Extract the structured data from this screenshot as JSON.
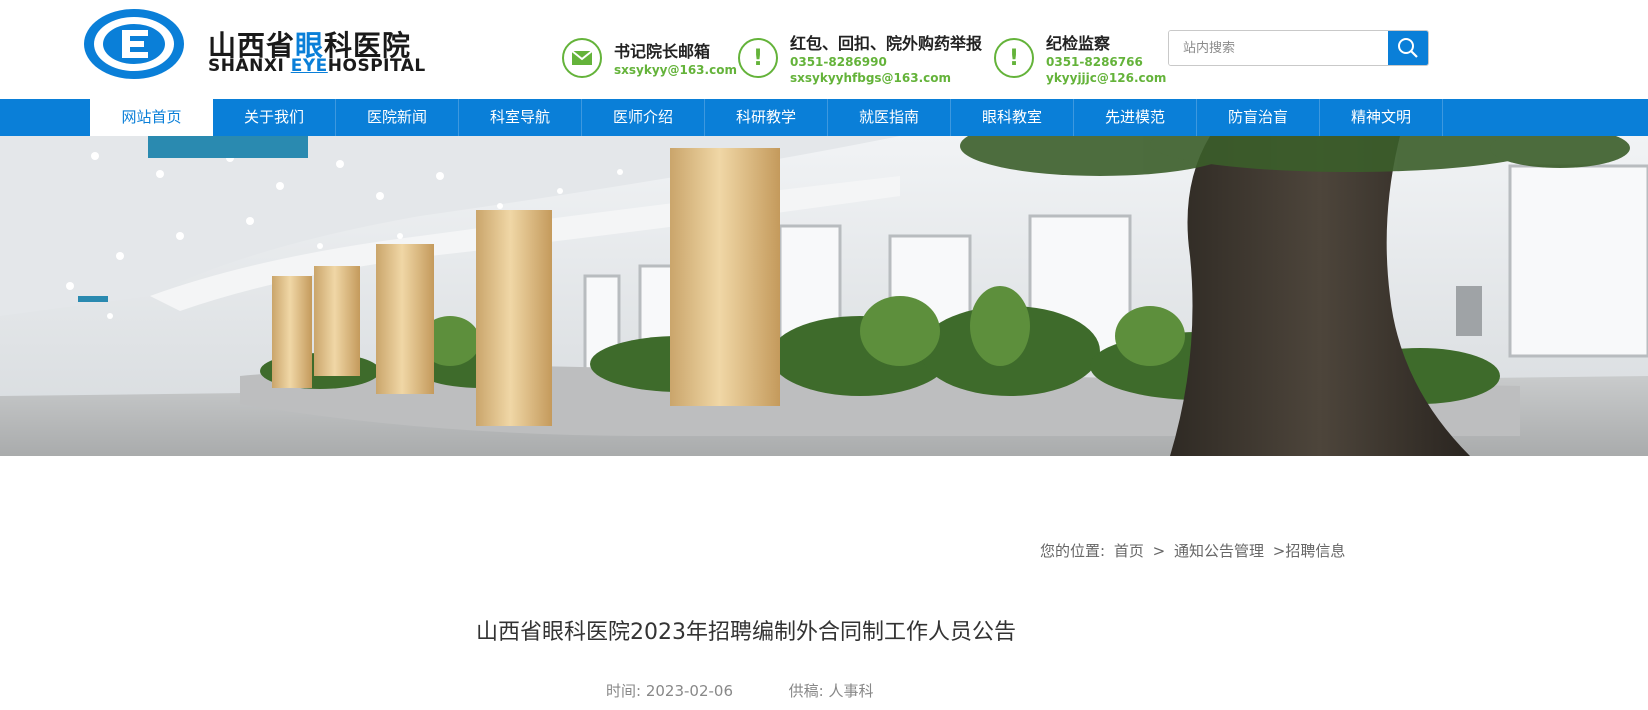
{
  "header": {
    "logo_cn_a": "山西省",
    "logo_cn_hl": "眼",
    "logo_cn_b": "科医院",
    "logo_en_a": "SHANXI ",
    "logo_en_hl": "EYE",
    "logo_en_b": "HOSPITAL",
    "contacts": [
      {
        "icon": "mail-icon",
        "title": "书记院长邮箱",
        "lines": [
          "sxsykyy@163.com"
        ]
      },
      {
        "icon": "exclamation-icon",
        "title": "红包、回扣、院外购药举报",
        "lines": [
          "0351-8286990",
          "sxsykyyhfbgs@163.com"
        ]
      },
      {
        "icon": "exclamation-icon",
        "title": "纪检监察",
        "lines": [
          "0351-8286766",
          "ykyyjjjc@126.com"
        ]
      }
    ],
    "search": {
      "placeholder": "站内搜索"
    }
  },
  "nav": {
    "items": [
      "网站首页",
      "关于我们",
      "医院新闻",
      "科室导航",
      "医师介绍",
      "科研教学",
      "就医指南",
      "眼科教室",
      "先进模范",
      "防盲治盲",
      "精神文明"
    ],
    "active_index": 0
  },
  "breadcrumb": {
    "prefix": "您的位置:",
    "home": "首页",
    "sep1": ">",
    "section": "通知公告管理",
    "sep2": ">",
    "current": "招聘信息"
  },
  "article": {
    "title": "山西省眼科医院2023年招聘编制外合同制工作人员公告",
    "time_label": "时间:",
    "time_value": "2023-02-06",
    "source_label": "供稿:",
    "source_value": "人事科"
  },
  "colors": {
    "brand_blue": "#0a7fd8",
    "green": "#64b33a"
  }
}
